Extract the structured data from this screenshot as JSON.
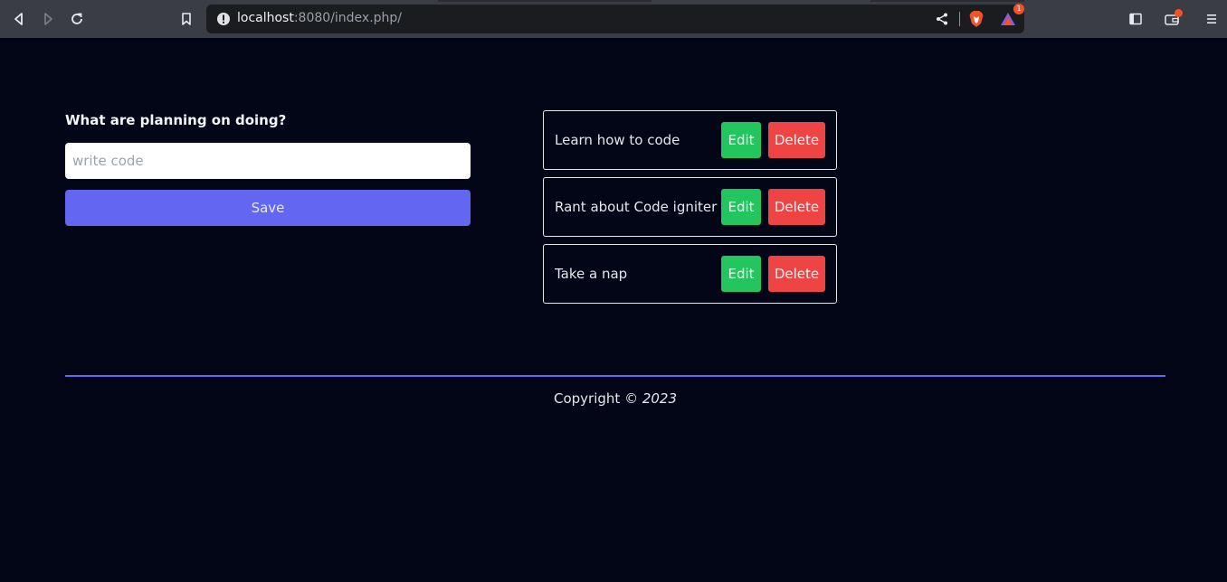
{
  "browser": {
    "url_host": "localhost",
    "url_rest": ":8080/index.php/",
    "rewards_badge": "1"
  },
  "form": {
    "label": "What are planning on doing?",
    "placeholder": "write code",
    "value": "",
    "save_label": "Save"
  },
  "todos": [
    {
      "text": "Learn how to code",
      "edit_label": "Edit",
      "delete_label": "Delete"
    },
    {
      "text": "Rant about Code igniter",
      "edit_label": "Edit",
      "delete_label": "Delete"
    },
    {
      "text": "Take a nap",
      "edit_label": "Edit",
      "delete_label": "Delete"
    }
  ],
  "footer": {
    "copyright": "Copyright",
    "symbol_year": "© 2023"
  },
  "colors": {
    "background": "#020617",
    "accent": "#6366f1",
    "edit": "#22c55e",
    "delete": "#ef4444"
  }
}
